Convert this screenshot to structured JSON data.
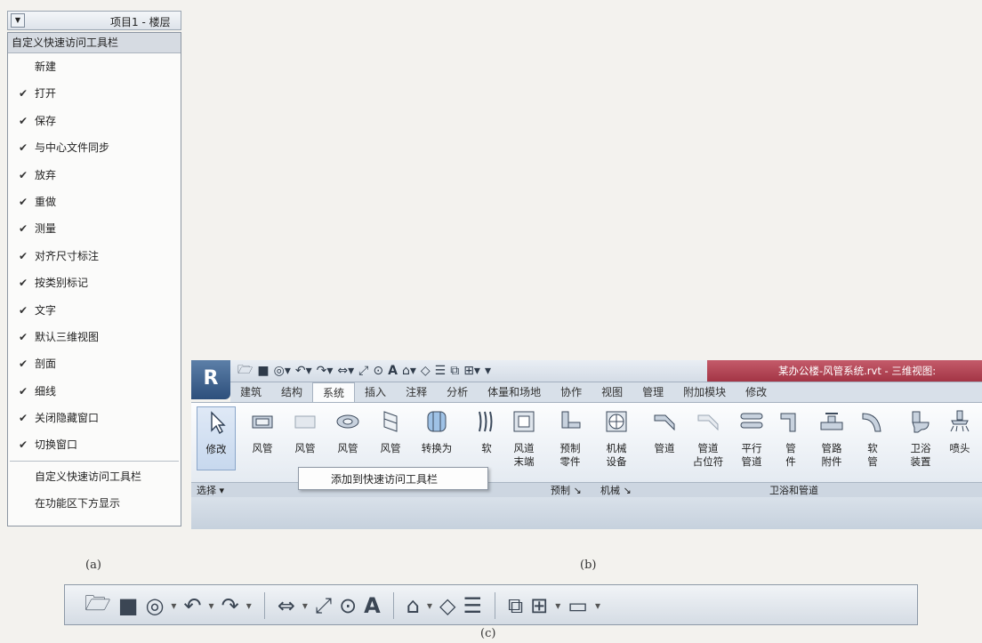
{
  "panel_a": {
    "qat_title": "项目1 - 楼层",
    "menu_header": "自定义快速访问工具栏",
    "items": [
      {
        "label": "新建",
        "checked": false
      },
      {
        "label": "打开",
        "checked": true
      },
      {
        "label": "保存",
        "checked": true
      },
      {
        "label": "与中心文件同步",
        "checked": true
      },
      {
        "label": "放弃",
        "checked": true
      },
      {
        "label": "重做",
        "checked": true
      },
      {
        "label": "测量",
        "checked": true
      },
      {
        "label": "对齐尺寸标注",
        "checked": true
      },
      {
        "label": "按类别标记",
        "checked": true
      },
      {
        "label": "文字",
        "checked": true
      },
      {
        "label": "默认三维视图",
        "checked": true
      },
      {
        "label": "剖面",
        "checked": true
      },
      {
        "label": "细线",
        "checked": true
      },
      {
        "label": "关闭隐藏窗口",
        "checked": true
      },
      {
        "label": "切换窗口",
        "checked": true
      }
    ],
    "footer_items": [
      "自定义快速访问工具栏",
      "在功能区下方显示"
    ],
    "caption": "(a)"
  },
  "panel_b": {
    "app_letter": "R",
    "title": "某办公楼-风管系统.rvt - 三维视图:",
    "tabs": [
      "建筑",
      "结构",
      "系统",
      "插入",
      "注释",
      "分析",
      "体量和场地",
      "协作",
      "视图",
      "管理",
      "附加模块",
      "修改"
    ],
    "active_tab": "系统",
    "buttons": {
      "modify": "修改",
      "duct1": "风管",
      "duct2": "风管",
      "duct3": "风管",
      "duct4": "风管",
      "convert": "转换为",
      "soft": "软",
      "terminal_top": "风道",
      "terminal_bottom": "末端",
      "prefab_top": "预制",
      "prefab_bottom": "零件",
      "mech_top": "机械",
      "mech_bottom": "设备",
      "pipe": "管道",
      "pipe_holder_top": "管道",
      "pipe_holder_bottom": "占位符",
      "parallel_top": "平行",
      "parallel_bottom": "管道",
      "fitting_top": "管",
      "fitting_bottom": "件",
      "accessory_top": "管路",
      "accessory_bottom": "附件",
      "flex_top": "软",
      "flex_bottom": "管",
      "plumbing_top": "卫浴",
      "plumbing_bottom": "装置",
      "sprinkler": "喷头"
    },
    "panel_labels": {
      "select": "选择 ▾",
      "prefab": "预制 ↘",
      "mechanical": "机械 ↘",
      "plumbing": "卫浴和管道"
    },
    "context_menu_item": "添加到快速访问工具栏",
    "caption": "(b)"
  },
  "panel_c": {
    "caption": "(c)"
  }
}
